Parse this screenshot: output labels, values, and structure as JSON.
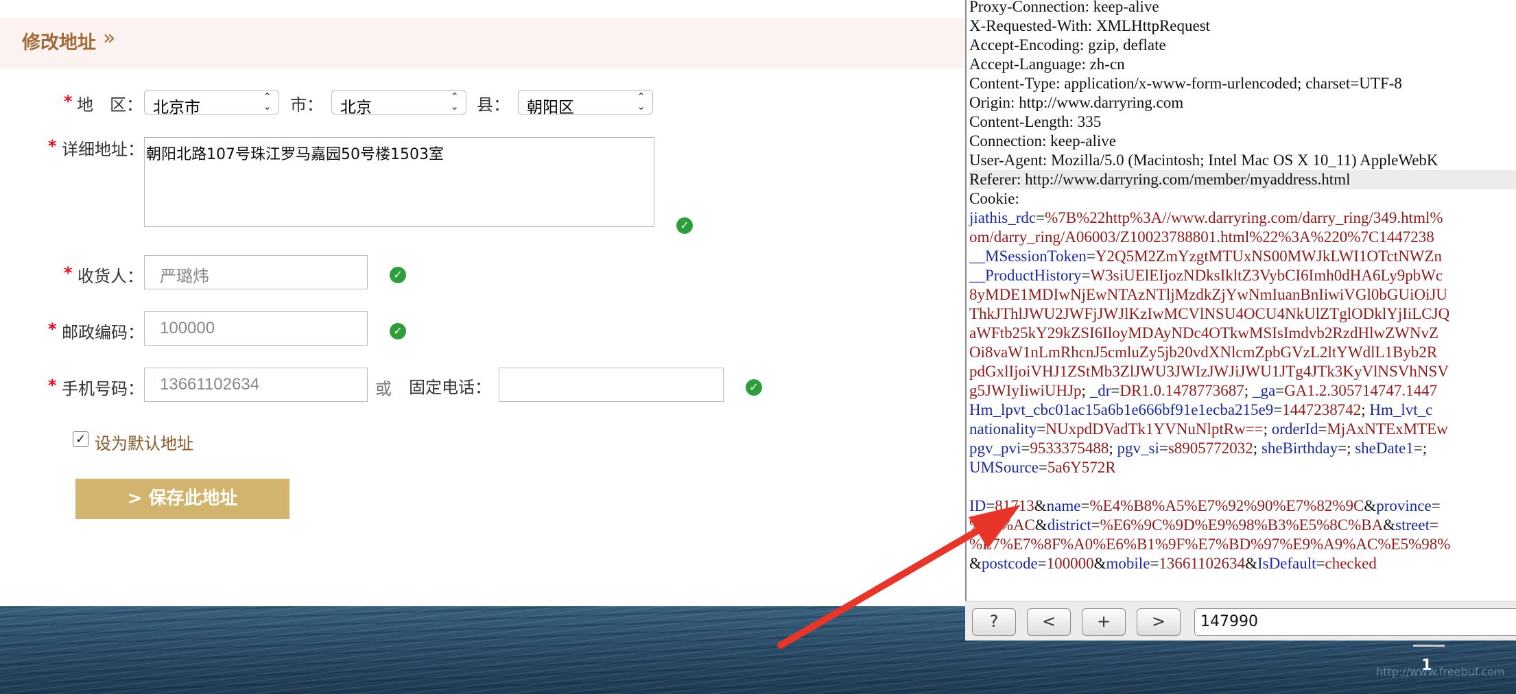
{
  "header": {
    "title": "修改地址",
    "arrow": "»"
  },
  "form": {
    "region": {
      "label": "地　区：",
      "province": "北京市",
      "city_label": "市：",
      "city": "北京",
      "county_label": "县：",
      "county": "朝阳区"
    },
    "detail": {
      "label": "详细地址：",
      "value": "朝阳北路107号珠江罗马嘉园50号楼1503室"
    },
    "receiver": {
      "label": "收货人：",
      "value": "严璐炜"
    },
    "postcode": {
      "label": "邮政编码：",
      "value": "100000"
    },
    "mobile": {
      "label": "手机号码：",
      "value": "13661102634",
      "or": "或",
      "phone_label": "固定电话：",
      "phone_value": ""
    },
    "default_address": {
      "label": "设为默认地址",
      "checked": true,
      "mark": "✓"
    },
    "save_button": "> 保存此地址",
    "required_mark": "*",
    "ok_mark": "✓"
  },
  "request": {
    "headers": [
      "Proxy-Connection: keep-alive",
      "X-Requested-With: XMLHttpRequest",
      "Accept-Encoding: gzip, deflate",
      "Accept-Language: zh-cn",
      "Content-Type: application/x-www-form-urlencoded; charset=UTF-8",
      "Origin: http://www.darryring.com",
      "Content-Length: 335",
      "Connection: keep-alive",
      "User-Agent: Mozilla/5.0 (Macintosh; Intel Mac OS X 10_11) AppleWebK",
      "Referer: http://www.darryring.com/member/myaddress.html",
      "Cookie:"
    ],
    "cookie_lines": [
      [
        [
          "k",
          "jiathis_rdc"
        ],
        [
          "p",
          "="
        ],
        [
          "v",
          "%7B%22http%3A//www.darryring.com/darry_ring/349.html%"
        ]
      ],
      [
        [
          "v",
          "om/darry_ring/A06003/Z10023788801.html%22%3A%220%7C1447238"
        ]
      ],
      [
        [
          "k",
          "__MSessionToken"
        ],
        [
          "p",
          "="
        ],
        [
          "v",
          "Y2Q5M2ZmYzgtMTUxNS00MWJkLWI1OTctNWZn"
        ]
      ],
      [
        [
          "k",
          "__ProductHistory"
        ],
        [
          "p",
          "="
        ],
        [
          "v",
          "W3siUElEIjozNDksIkltZ3VybCI6Imh0dHA6Ly9pbWc"
        ]
      ],
      [
        [
          "v",
          "8yMDE1MDIwNjEwNTAzNTljMzdkZjYwNmIuanBnIiwiVGl0bGUiOiJU"
        ]
      ],
      [
        [
          "v",
          "ThkJThlJWU2JWFjJWJlKzIwMCVlNSU4OCU4NkUlZTglODklYjIiLCJQ"
        ]
      ],
      [
        [
          "v",
          "aWFtb25kY29kZSI6IloyMDAyNDc4OTkwMSIsImdvb2RzdHlwZWNvZ"
        ]
      ],
      [
        [
          "v",
          "Oi8vaW1nLmRhcnJ5cmluZy5jb20vdXNlcmZpbGVzL2ltYWdlL1Byb2R"
        ]
      ],
      [
        [
          "v",
          "pdGxlIjoiVHJ1ZStMb3ZlJWU3JWIzJWJiJWU1JTg4JTk3KyVlNSVhNSV"
        ]
      ],
      [
        [
          "v",
          "g5JWIyIiwiUHJp"
        ],
        [
          "p",
          "; "
        ],
        [
          "k",
          "_dr"
        ],
        [
          "p",
          "="
        ],
        [
          "v",
          "DR1.0.1478773687"
        ],
        [
          "p",
          "; "
        ],
        [
          "k",
          "_ga"
        ],
        [
          "p",
          "="
        ],
        [
          "v",
          "GA1.2.305714747.1447"
        ]
      ],
      [
        [
          "k",
          "Hm_lpvt_cbc01ac15a6b1e666bf91e1ecba215e9"
        ],
        [
          "p",
          "="
        ],
        [
          "v",
          "1447238742"
        ],
        [
          "p",
          "; "
        ],
        [
          "k",
          "Hm_lvt_c"
        ]
      ],
      [
        [
          "k",
          "nationality"
        ],
        [
          "p",
          "="
        ],
        [
          "v",
          "NUxpdDVadTk1YVNuNlptRw=="
        ],
        [
          "p",
          "; "
        ],
        [
          "k",
          "orderId"
        ],
        [
          "p",
          "="
        ],
        [
          "v",
          "MjAxNTExMTEw"
        ]
      ],
      [
        [
          "k",
          "pgv_pvi"
        ],
        [
          "p",
          "="
        ],
        [
          "v",
          "9533375488"
        ],
        [
          "p",
          "; "
        ],
        [
          "k",
          "pgv_si"
        ],
        [
          "p",
          "="
        ],
        [
          "v",
          "s8905772032"
        ],
        [
          "p",
          "; "
        ],
        [
          "k",
          "sheBirthday"
        ],
        [
          "p",
          "=; "
        ],
        [
          "k",
          "sheDate1"
        ],
        [
          "p",
          "=;"
        ]
      ],
      [
        [
          "k",
          "UMSource"
        ],
        [
          "p",
          "="
        ],
        [
          "v",
          "5a6Y572R"
        ]
      ]
    ],
    "body_lines": [
      [
        [
          "k",
          "ID"
        ],
        [
          "p",
          "="
        ],
        [
          "v",
          "81713"
        ],
        [
          "p",
          "&"
        ],
        [
          "k",
          "name"
        ],
        [
          "p",
          "="
        ],
        [
          "v",
          "%E4%B8%A5%E7%92%90%E7%82%9C"
        ],
        [
          "p",
          "&"
        ],
        [
          "k",
          "province"
        ],
        [
          "p",
          "="
        ]
      ],
      [
        [
          "v",
          "%E5%AC"
        ],
        [
          "p",
          "&"
        ],
        [
          "k",
          "district"
        ],
        [
          "p",
          "="
        ],
        [
          "v",
          "%E6%9C%9D%E9%98%B3%E5%8C%BA"
        ],
        [
          "p",
          "&"
        ],
        [
          "k",
          "street"
        ],
        [
          "p",
          "="
        ]
      ],
      [
        [
          "v",
          "%E7%E7%8F%A0%E6%B1%9F%E7%BD%97%E9%A9%AC%E5%98%"
        ]
      ],
      [
        [
          "p",
          "&"
        ],
        [
          "k",
          "postcode"
        ],
        [
          "p",
          "="
        ],
        [
          "v",
          "100000"
        ],
        [
          "p",
          "&"
        ],
        [
          "k",
          "mobile"
        ],
        [
          "p",
          "="
        ],
        [
          "v",
          "13661102634"
        ],
        [
          "p",
          "&"
        ],
        [
          "k",
          "IsDefault"
        ],
        [
          "p",
          "="
        ],
        [
          "v",
          "checked"
        ]
      ]
    ]
  },
  "navbar": {
    "help": "?",
    "prev": "<",
    "add": "+",
    "next": ">",
    "search_value": "147990"
  },
  "page_number": "1",
  "watermark": "http://www.freebuf.com",
  "colors": {
    "accent": "#a06a3a",
    "save_button": "#d2b46e",
    "ok_green": "#2e9e3a",
    "annotation_arrow": "#e8352a",
    "key_blue": "#1c2a9c",
    "value_red": "#8e1c1c"
  }
}
